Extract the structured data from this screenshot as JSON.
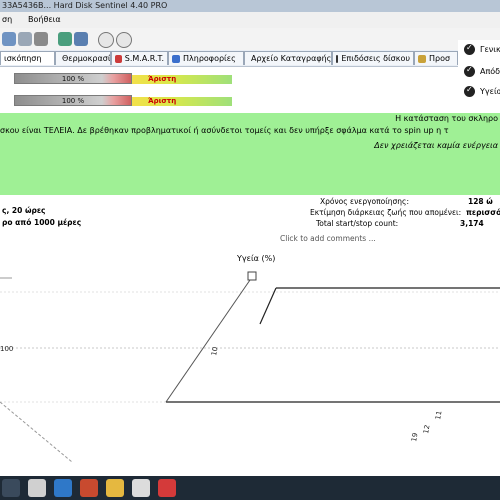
{
  "titlebar": {
    "title": "33A5436B... Hard Disk Sentinel 4.40 PRO"
  },
  "menubar": {
    "items": [
      "ση",
      "Βοήθεια"
    ]
  },
  "tabs": [
    {
      "label": "ισκόπηση",
      "active": true
    },
    {
      "label": "Θερμοκρασία"
    },
    {
      "label": "S.M.A.R.T."
    },
    {
      "label": "Πληροφορίες"
    },
    {
      "label": "Αρχείο Καταγραφής"
    },
    {
      "label": "Επιδόσεις δίσκου"
    },
    {
      "label": "Προσ"
    }
  ],
  "right_panel": {
    "items": [
      {
        "label": "Γενικ",
        "icon": "check-icon"
      },
      {
        "label": "Απόδοση",
        "icon": "check-icon"
      },
      {
        "label": "Υγεία",
        "icon": "check-icon"
      }
    ]
  },
  "performance": {
    "bar_value": 100,
    "bar_label": "100 %",
    "rating": "Άριστη"
  },
  "health": {
    "bar_value": 100,
    "bar_label": "100 %",
    "rating": "Άριστη"
  },
  "status": {
    "line1": "Η κατάσταση του σκληρο",
    "line2": "σκου είναι ΤΕΛΕΙΑ. Δε βρέθηκαν προβληματικοί ή ασύνδετοι τομείς και δεν υπήρξε σφάλμα κατά το spin up η τ",
    "line3": "Δεν χρειάζεται καμία ενέργεια"
  },
  "left_info": {
    "line1": "ς, 20 ώρες",
    "line2": "ρο από 1000 μέρες"
  },
  "right_info": {
    "rows": [
      {
        "label": "Χρόνος ενεργοποίησης:",
        "value": "128 ώ"
      },
      {
        "label": "Εκτίμηση διάρκειας ζωής που απομένει:",
        "value": "περισσό"
      },
      {
        "label": "Total start/stop count:",
        "value": "3,174"
      }
    ]
  },
  "comment": {
    "placeholder": "Click to add comments ..."
  },
  "chart_data": {
    "type": "line",
    "title": "Υγεία (%)",
    "ylabel": "",
    "xlabel": "",
    "y_tick_labels": [
      "100"
    ],
    "x_tick_labels": [
      "10",
      "11",
      "12",
      "19"
    ],
    "series": [
      {
        "values": [
          100,
          100,
          100,
          100
        ]
      }
    ],
    "grid": true
  },
  "colors": {
    "green_box": "#9ff095",
    "rating_text": "#cc0000",
    "taskbar": "#1e2a36"
  }
}
